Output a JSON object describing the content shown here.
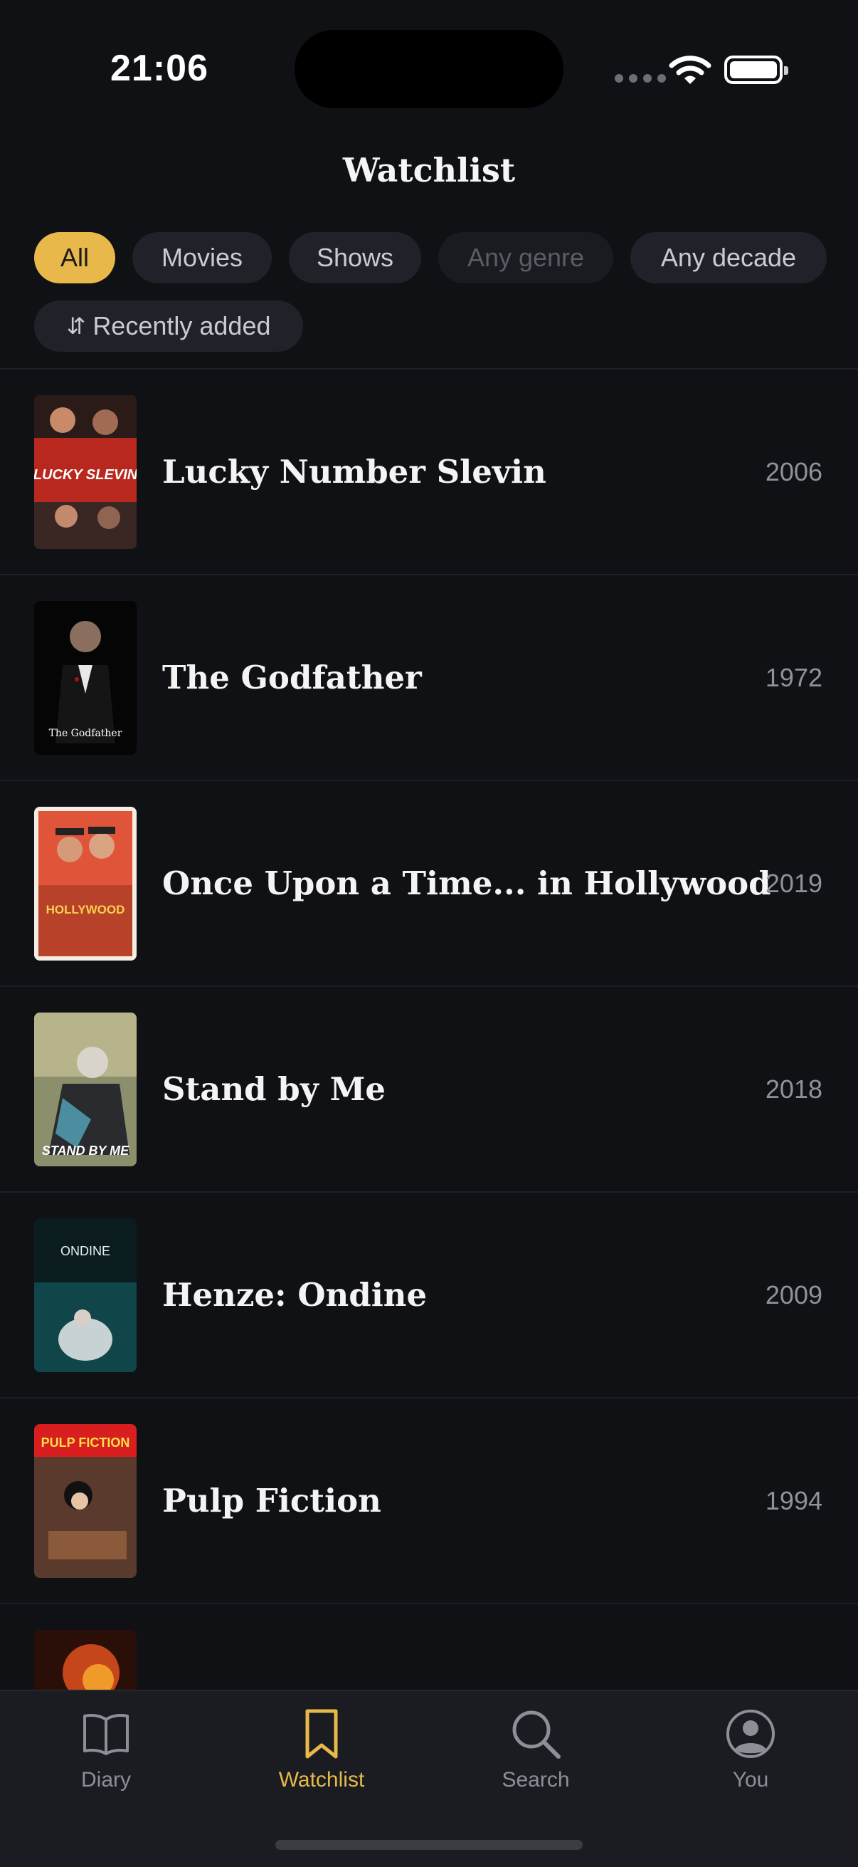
{
  "status_bar": {
    "time": "21:06"
  },
  "header": {
    "title": "Watchlist"
  },
  "filters": {
    "type_all": "All",
    "type_movies": "Movies",
    "type_shows": "Shows",
    "genre": "Any genre",
    "decade": "Any decade",
    "sort": "Recently added",
    "sort_icon": "⇵"
  },
  "list": [
    {
      "title": "Lucky Number Slevin",
      "year": "2006",
      "poster_text": "LUCKY SLEVIN"
    },
    {
      "title": "The Godfather",
      "year": "1972",
      "poster_text": "The Godfather"
    },
    {
      "title": "Once Upon a Time... in Hollywood",
      "year": "2019",
      "poster_text": "HOLLYWOOD"
    },
    {
      "title": "Stand by Me",
      "year": "2018",
      "poster_text": "STAND BY ME"
    },
    {
      "title": "Henze: Ondine",
      "year": "2009",
      "poster_text": "ONDINE"
    },
    {
      "title": "Pulp Fiction",
      "year": "1994",
      "poster_text": "PULP FICTION"
    }
  ],
  "tab_bar": {
    "diary": "Diary",
    "watchlist": "Watchlist",
    "search": "Search",
    "you": "You"
  },
  "colors": {
    "accent": "#e8b84a",
    "background": "#0f1115",
    "chip": "#1f2229"
  }
}
